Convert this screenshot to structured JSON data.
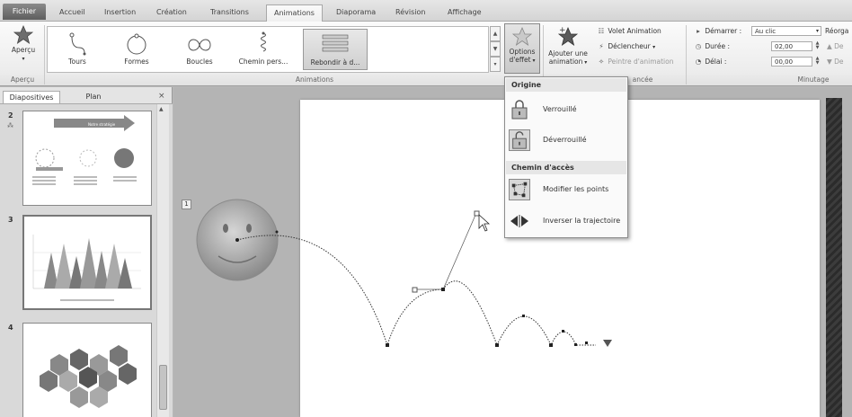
{
  "tabs": [
    {
      "label": "Fichier"
    },
    {
      "label": "Accueil"
    },
    {
      "label": "Insertion"
    },
    {
      "label": "Création"
    },
    {
      "label": "Transitions"
    },
    {
      "label": "Animations"
    },
    {
      "label": "Diaporama"
    },
    {
      "label": "Révision"
    },
    {
      "label": "Affichage"
    }
  ],
  "ribbon": {
    "preview": {
      "label": "Aperçu",
      "group": "Aperçu"
    },
    "gallery": [
      {
        "label": "Tours"
      },
      {
        "label": "Formes"
      },
      {
        "label": "Boucles"
      },
      {
        "label": "Chemin pers..."
      },
      {
        "label": "Rebondir à d..."
      }
    ],
    "animations_group": "Animations",
    "effect_options": {
      "line1": "Options",
      "line2": "d'effet"
    },
    "add_animation": {
      "line1": "Ajouter une",
      "line2": "animation"
    },
    "advanced": {
      "pane": "Volet Animation",
      "trigger": "Déclencheur",
      "painter": "Peintre d'animation",
      "group": "ancée"
    },
    "timing": {
      "start_label": "Démarrer :",
      "start_value": "Au clic",
      "duration_label": "Durée :",
      "duration_value": "02,00",
      "delay_label": "Délai :",
      "delay_value": "00,00",
      "reorder_label": "Réorga",
      "up_label": "De",
      "down_label": "De",
      "group": "Minutage"
    }
  },
  "panel": {
    "tab_slides": "Diapositives",
    "tab_outline": "Plan",
    "close": "×",
    "slides": [
      {
        "num": "2",
        "banner": "Notre stratégie"
      },
      {
        "num": "3"
      },
      {
        "num": "4"
      }
    ]
  },
  "canvas": {
    "marker": "1"
  },
  "dropdown": {
    "origin_header": "Origine",
    "locked": "Verrouillé",
    "unlocked": "Déverrouillé",
    "path_header": "Chemin d'accès",
    "edit_points": "Modifier les points",
    "reverse_path": "Inverser la trajectoire"
  }
}
